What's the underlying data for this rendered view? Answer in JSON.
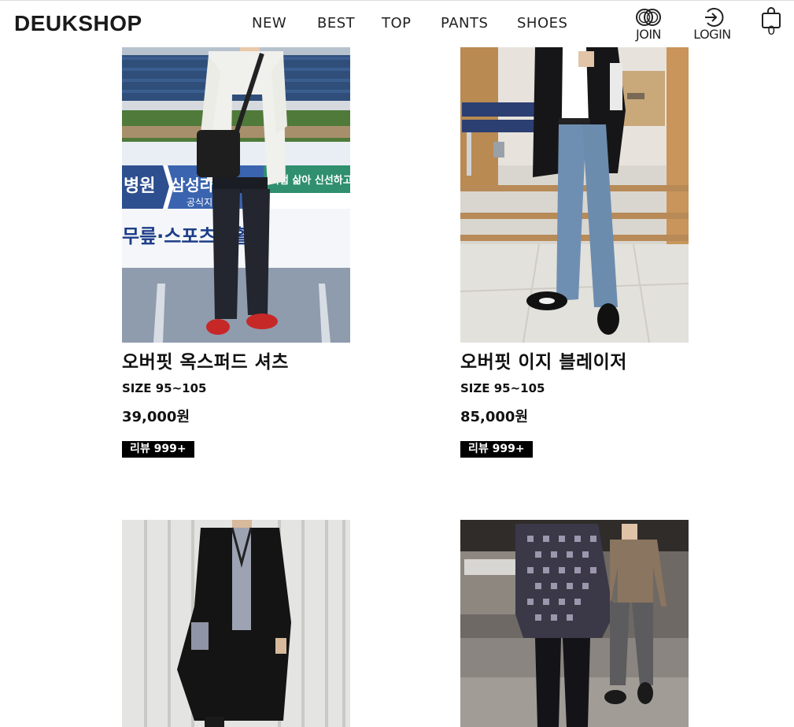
{
  "header": {
    "logo": "DEUKSHOP",
    "nav": [
      {
        "label": "NEW"
      },
      {
        "label": "BEST"
      },
      {
        "label": "TOP"
      },
      {
        "label": "PANTS"
      },
      {
        "label": "SHOES"
      }
    ],
    "join_label": "JOIN",
    "login_label": "LOGIN",
    "cart_count": "0"
  },
  "products": [
    {
      "name": "오버핏 옥스퍼드 셔츠",
      "size": "SIZE 95~105",
      "price": "39,000원",
      "review": "리뷰 999+",
      "photo_signage": [
        "병원",
        "삼성라",
        "공식지정",
        "무릎·스포츠재활",
        "직접 삶아 신선하고"
      ]
    },
    {
      "name": "오버핏 이지 블레이저",
      "size": "SIZE 95~105",
      "price": "85,000원",
      "review": "리뷰 999+"
    },
    {
      "name": "",
      "size": "",
      "price": "",
      "review": ""
    },
    {
      "name": "",
      "size": "",
      "price": "",
      "review": ""
    }
  ],
  "colors": {
    "review_badge_bg": "#000000",
    "review_badge_text": "#ffffff",
    "header_border": "#dddddd"
  },
  "icons": {
    "join": "rings-icon",
    "login": "login-arrow-icon",
    "cart": "shopping-bag-icon"
  }
}
